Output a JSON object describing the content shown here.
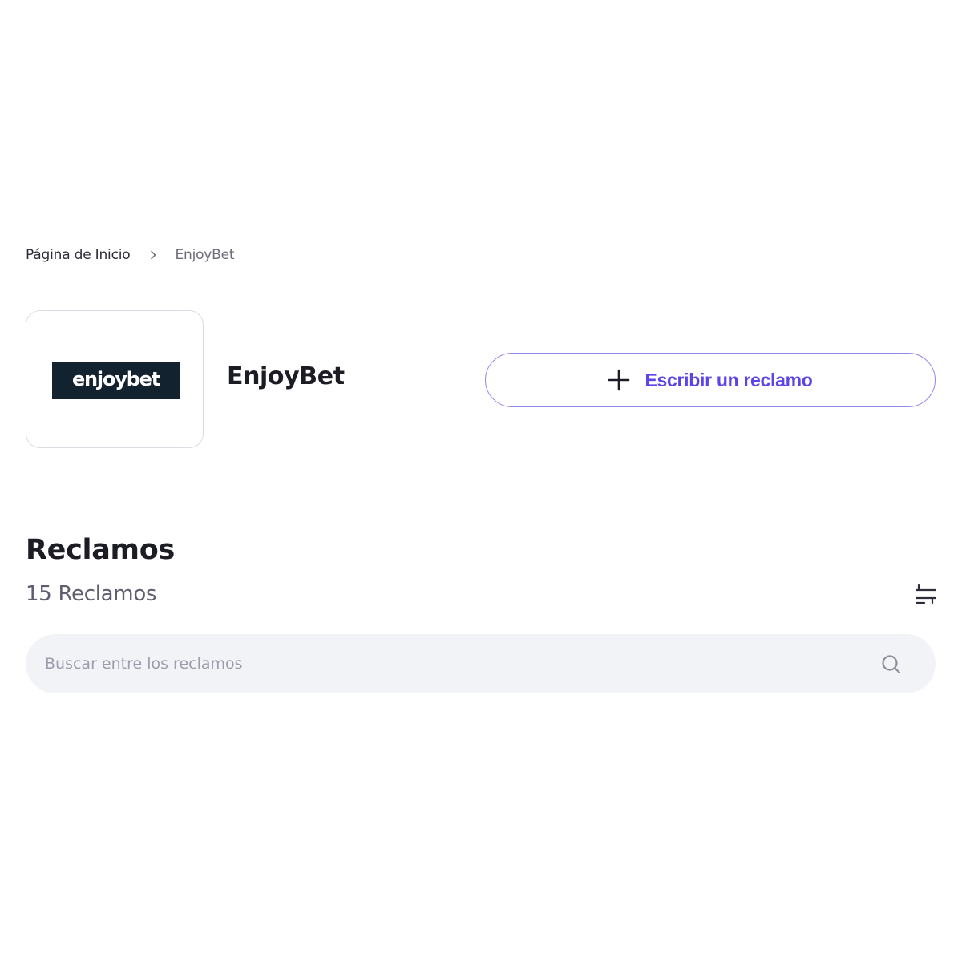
{
  "breadcrumb": {
    "home": "Página de Inicio",
    "current": "EnjoyBet"
  },
  "company": {
    "logo_text": "enjoybet",
    "name": "EnjoyBet"
  },
  "actions": {
    "write_complaint": "Escribir un reclamo"
  },
  "complaints": {
    "title": "Reclamos",
    "count_label": "15 Reclamos"
  },
  "search": {
    "placeholder": "Buscar entre los reclamos"
  },
  "icons": {
    "breadcrumb_separator": "chevron-right-icon",
    "write": "plus-icon",
    "filter": "sliders-icon",
    "search": "search-icon"
  },
  "colors": {
    "accent": "#5b45ea",
    "accent_border": "#8f86f0",
    "logo_background": "#13222f",
    "search_background": "#f2f3f7"
  }
}
